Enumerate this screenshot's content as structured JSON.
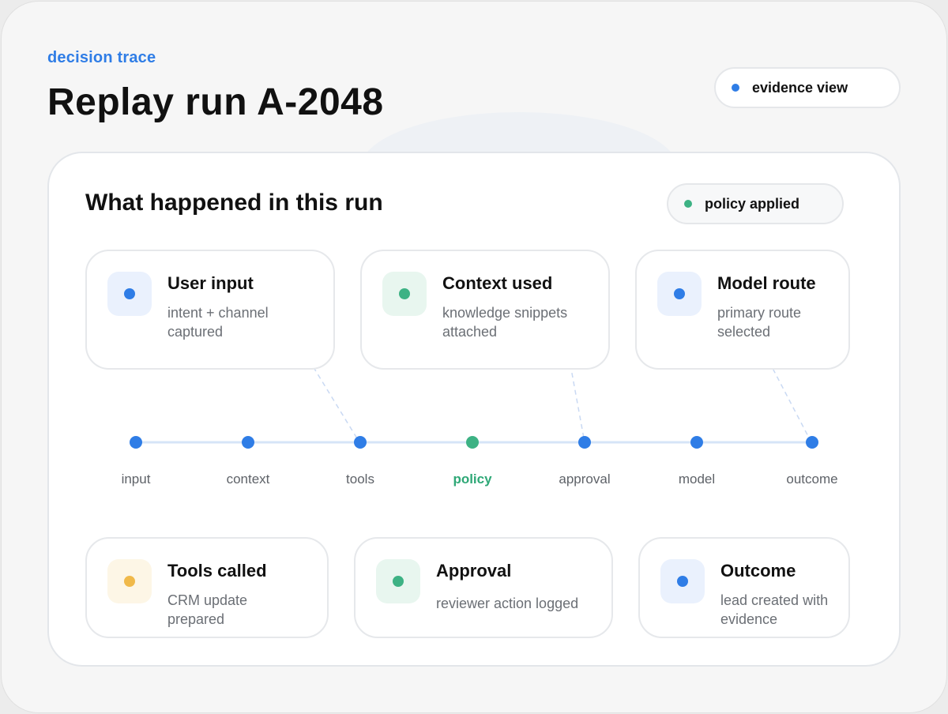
{
  "header": {
    "eyebrow": "decision trace",
    "title": "Replay run A-2048",
    "view_pill": {
      "label": "evidence view",
      "dot_color": "#2f7de6"
    }
  },
  "panel": {
    "title": "What happened in this run",
    "status_pill": {
      "label": "policy applied",
      "dot_color": "#3db284"
    }
  },
  "steps_top": [
    {
      "title": "User input",
      "description": "intent + channel captured",
      "icon": "blue-dot-icon"
    },
    {
      "title": "Context used",
      "description": "knowledge snippets attached",
      "icon": "green-dot-icon"
    },
    {
      "title": "Model route",
      "description": "primary route selected",
      "icon": "blue-dot-icon"
    }
  ],
  "timeline": {
    "nodes": [
      {
        "label": "input",
        "state": "default"
      },
      {
        "label": "context",
        "state": "default"
      },
      {
        "label": "tools",
        "state": "default"
      },
      {
        "label": "policy",
        "state": "active"
      },
      {
        "label": "approval",
        "state": "default"
      },
      {
        "label": "model",
        "state": "default"
      },
      {
        "label": "outcome",
        "state": "default"
      }
    ],
    "colors": {
      "node": "#2f7de6",
      "active": "#3db284",
      "line": "#d6e4f7"
    }
  },
  "steps_bottom": [
    {
      "title": "Tools called",
      "description": "CRM update prepared",
      "icon": "amber-dot-icon"
    },
    {
      "title": "Approval",
      "description": "reviewer action logged",
      "icon": "green-dot-icon"
    },
    {
      "title": "Outcome",
      "description": "lead created with evidence",
      "icon": "blue-dot-icon"
    }
  ]
}
